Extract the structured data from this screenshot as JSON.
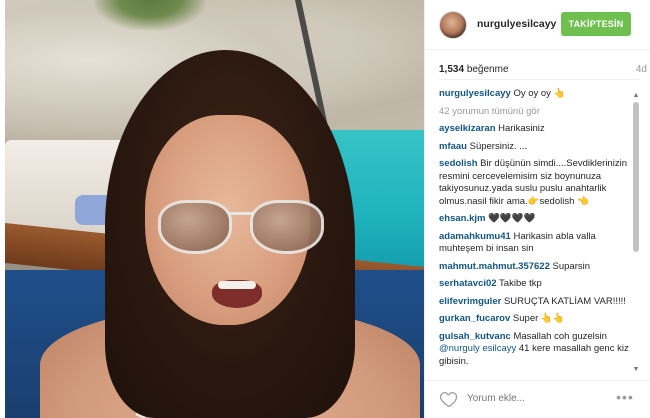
{
  "post": {
    "username": "nurgulyesilcayy",
    "follow_label": "TAKİPTESİN",
    "likes_count": "1,534",
    "likes_word": "beğenme",
    "time_ago": "4d",
    "colors": {
      "follow_button": "#70c050",
      "username_link": "#125688"
    }
  },
  "comments": [
    {
      "user": "nurgulyesilcayy",
      "text": " Oy oy oy 👆"
    },
    {
      "more_label": "42 yorumun tümünü gör"
    },
    {
      "user": "ayselkizaran",
      "text": " Harikasiniz"
    },
    {
      "user": "mfaau",
      "text": " Süpersiniz. ..."
    },
    {
      "user": "sedolish",
      "text": " Bir düşünün simdi....Sevdiklerinizin resmini cercevelemisim siz boynunuza takiyosunuz.yada suslu puslu anahtarlik olmus.nasil fikir ama.👉sedolish 👈"
    },
    {
      "user": "ehsan.kjm",
      "text": " 🖤🖤🖤🖤"
    },
    {
      "user": "adamahkumu41",
      "text": " Harikasin abla valla muhteşem bi insan sin"
    },
    {
      "user": "mahmut.mahmut.357622",
      "text": " Suparsin"
    },
    {
      "user": "serhatavci02",
      "text": " Takibe tkp"
    },
    {
      "user": "elifevrimguler",
      "text": " SURUÇTA KATLİAM VAR!!!!!"
    },
    {
      "user": "gurkan_fucarov",
      "text": " Super 👆👆"
    },
    {
      "user": "gulsah_kutvanc",
      "text": " Masallah coh guzelsin ",
      "mention": "@nurguly esilcayy",
      "after": " 41 kere masallah genc kiz gibisin."
    }
  ],
  "footer": {
    "add_comment_placeholder": "Yorum ekle...",
    "heart_icon": "heart-outline-icon",
    "more_icon": "more-options-icon"
  }
}
